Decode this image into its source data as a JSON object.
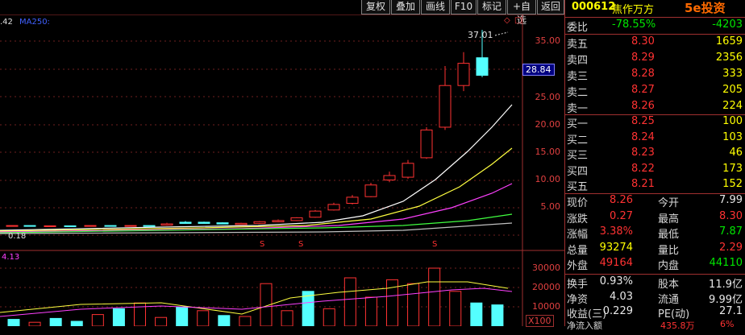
{
  "toolbar": {
    "buttons": [
      "复权",
      "叠加",
      "画线",
      "F10",
      "标记",
      "+自选",
      "返回"
    ]
  },
  "chart": {
    "ma_prefix": ".42",
    "ma_label": "MA250:",
    "price_ticks": [
      "35.00",
      "30.00",
      "25.00",
      "20.00",
      "15.00",
      "10.00",
      "5.00"
    ],
    "high_label": "37.01",
    "current_price_tag": "28.84",
    "low_label": "0.18",
    "volume_ticks": [
      "30000",
      "20000",
      "10000"
    ],
    "volume_prefix": "4.13",
    "volume_unit": "X100"
  },
  "chart_data": {
    "type": "candlestick",
    "candles": [
      {
        "o": 1.9,
        "c": 2.1,
        "h": 2.3,
        "l": 1.8,
        "up": true
      },
      {
        "o": 2.4,
        "c": 2.3,
        "h": 2.6,
        "l": 2.2,
        "up": false
      },
      {
        "o": 2.3,
        "c": 2.4,
        "h": 2.5,
        "l": 2.2,
        "up": false
      },
      {
        "o": 2.2,
        "c": 2.3,
        "h": 2.4,
        "l": 2.1,
        "up": false
      },
      {
        "o": 2.1,
        "c": 2.2,
        "h": 2.3,
        "l": 2.0,
        "up": true
      },
      {
        "o": 2.2,
        "c": 2.5,
        "h": 2.6,
        "l": 2.1,
        "up": true
      },
      {
        "o": 2.5,
        "c": 2.7,
        "h": 2.9,
        "l": 2.4,
        "up": true
      },
      {
        "o": 2.7,
        "c": 3.2,
        "h": 3.3,
        "l": 2.6,
        "up": true
      },
      {
        "o": 3.3,
        "c": 4.4,
        "h": 4.6,
        "l": 3.2,
        "up": true
      },
      {
        "o": 4.6,
        "c": 5.6,
        "h": 5.9,
        "l": 4.5,
        "up": true
      },
      {
        "o": 5.8,
        "c": 6.9,
        "h": 7.3,
        "l": 5.6,
        "up": true
      },
      {
        "o": 7.0,
        "c": 9.1,
        "h": 9.5,
        "l": 6.9,
        "up": true
      },
      {
        "o": 10.0,
        "c": 10.8,
        "h": 11.5,
        "l": 9.6,
        "up": true
      },
      {
        "o": 10.5,
        "c": 13.0,
        "h": 13.6,
        "l": 10.2,
        "up": true
      },
      {
        "o": 14.0,
        "c": 19.0,
        "h": 19.5,
        "l": 13.8,
        "up": true
      },
      {
        "o": 19.5,
        "c": 27.0,
        "h": 30.5,
        "l": 19.0,
        "up": true
      },
      {
        "o": 27.0,
        "c": 31.0,
        "h": 33.0,
        "l": 26.0,
        "up": true
      },
      {
        "o": 32.0,
        "c": 28.84,
        "h": 37.01,
        "l": 28.5,
        "up": false
      }
    ],
    "volumes": [
      {
        "v": 3500,
        "up": false
      },
      {
        "v": 2000,
        "up": true
      },
      {
        "v": 4000,
        "up": false
      },
      {
        "v": 2500,
        "up": false
      },
      {
        "v": 6000,
        "up": true
      },
      {
        "v": 9000,
        "up": false
      },
      {
        "v": 12000,
        "up": true
      },
      {
        "v": 4500,
        "up": true
      },
      {
        "v": 10000,
        "up": false
      },
      {
        "v": 8000,
        "up": true
      },
      {
        "v": 5500,
        "up": false
      },
      {
        "v": 5000,
        "up": true
      },
      {
        "v": 22000,
        "up": true
      },
      {
        "v": 8000,
        "up": true
      },
      {
        "v": 18000,
        "up": false
      },
      {
        "v": 9000,
        "up": true
      },
      {
        "v": 25000,
        "up": true
      },
      {
        "v": 15000,
        "up": true
      },
      {
        "v": 24000,
        "up": true
      },
      {
        "v": 22000,
        "up": true
      },
      {
        "v": 30000,
        "up": true
      },
      {
        "v": 18000,
        "up": true
      },
      {
        "v": 12000,
        "up": false
      },
      {
        "v": 11000,
        "up": false
      }
    ]
  },
  "quote": {
    "code": "000612",
    "name": "焦作万方",
    "logo_text": "5e投资",
    "weibi": {
      "label": "委比",
      "value": "-78.55%",
      "diff": "-4203"
    },
    "sell": [
      {
        "label": "卖五",
        "price": "8.30",
        "vol": "1659"
      },
      {
        "label": "卖四",
        "price": "8.29",
        "vol": "2356"
      },
      {
        "label": "卖三",
        "price": "8.28",
        "vol": "333"
      },
      {
        "label": "卖二",
        "price": "8.27",
        "vol": "205"
      },
      {
        "label": "卖一",
        "price": "8.26",
        "vol": "224"
      }
    ],
    "buy": [
      {
        "label": "买一",
        "price": "8.25",
        "vol": "100"
      },
      {
        "label": "买二",
        "price": "8.24",
        "vol": "103"
      },
      {
        "label": "买三",
        "price": "8.23",
        "vol": "46"
      },
      {
        "label": "买四",
        "price": "8.22",
        "vol": "173"
      },
      {
        "label": "买五",
        "price": "8.21",
        "vol": "152"
      }
    ],
    "stats": [
      {
        "l1": "现价",
        "v1": "8.26",
        "c1": "red",
        "l2": "今开",
        "v2": "7.99",
        "c2": "white"
      },
      {
        "l1": "涨跌",
        "v1": "0.27",
        "c1": "red",
        "l2": "最高",
        "v2": "8.30",
        "c2": "red"
      },
      {
        "l1": "涨幅",
        "v1": "3.38%",
        "c1": "red",
        "l2": "最低",
        "v2": "7.87",
        "c2": "green"
      },
      {
        "l1": "总量",
        "v1": "93274",
        "c1": "yellow",
        "l2": "量比",
        "v2": "2.29",
        "c2": "red"
      },
      {
        "l1": "外盘",
        "v1": "49164",
        "c1": "red",
        "l2": "内盘",
        "v2": "44110",
        "c2": "green"
      }
    ],
    "fund": [
      {
        "l1": "换手",
        "v1": "0.93%",
        "l2": "股本",
        "v2": "11.9亿"
      },
      {
        "l1": "净资",
        "v1": "4.03",
        "l2": "流通",
        "v2": "9.99亿"
      },
      {
        "l1": "收益(三)",
        "v1": "0.229",
        "l2": "PE(动)",
        "v2": "27.1"
      }
    ],
    "bottom_text": "净流入额",
    "bottom_value": "435.8万",
    "bottom_pct": "6%"
  }
}
